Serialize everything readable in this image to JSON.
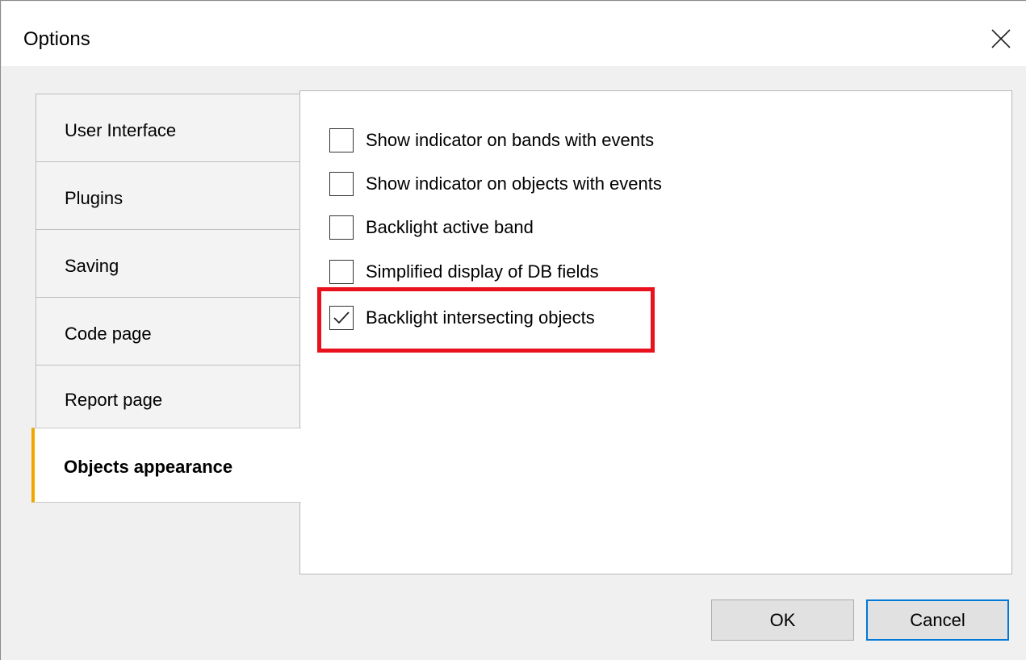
{
  "window": {
    "title": "Options",
    "close_icon": "close-icon"
  },
  "tabs": [
    {
      "label": "User Interface",
      "active": false
    },
    {
      "label": "Plugins",
      "active": false
    },
    {
      "label": "Saving",
      "active": false
    },
    {
      "label": "Code page",
      "active": false
    },
    {
      "label": "Report page",
      "active": false
    },
    {
      "label": "Objects appearance",
      "active": true
    }
  ],
  "options": [
    {
      "label": "Show indicator on bands with events",
      "checked": false
    },
    {
      "label": "Show indicator on objects with events",
      "checked": false
    },
    {
      "label": "Backlight active band",
      "checked": false
    },
    {
      "label": "Simplified display of DB fields",
      "checked": false
    },
    {
      "label": "Backlight intersecting objects",
      "checked": true
    }
  ],
  "buttons": {
    "ok": "OK",
    "cancel": "Cancel"
  },
  "colors": {
    "active_tab_accent": "#f0a800",
    "highlight": "#e8111c",
    "default_button_border": "#0078d7"
  }
}
